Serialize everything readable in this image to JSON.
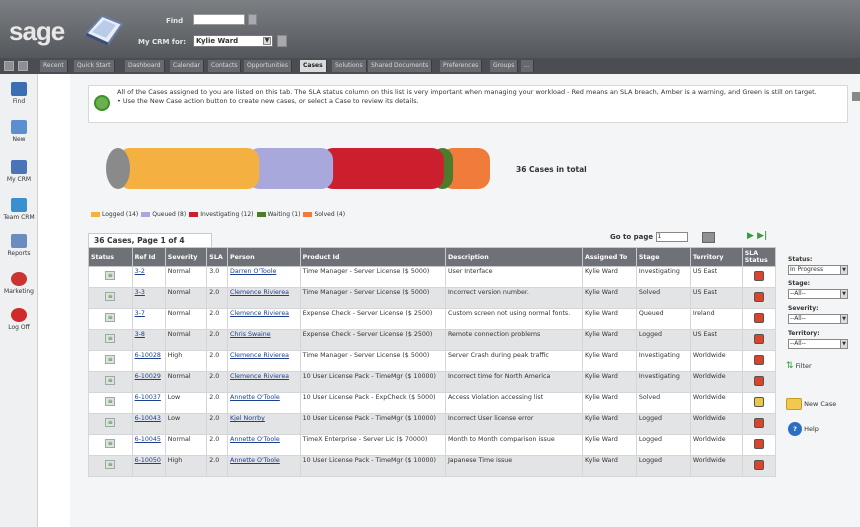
{
  "header": {
    "logo": "sage",
    "find_label": "Find",
    "find_value": "",
    "my_crm_label": "My CRM for:",
    "my_crm_user": "Kylie Ward"
  },
  "tabs": [
    "Quick Start",
    "Dashboard",
    "Calendar",
    "Contacts",
    "Opportunities",
    "Cases",
    "Solutions",
    "Shared Documents",
    "Preferences",
    "Groups",
    "..."
  ],
  "tabs_prefix": "Recent",
  "active_tab": "Cases",
  "sidebar": [
    {
      "label": "Find",
      "icon": "magnifier-icon"
    },
    {
      "label": "New",
      "icon": "new-document-icon"
    },
    {
      "label": "My CRM",
      "icon": "my-crm-icon"
    },
    {
      "label": "Team CRM",
      "icon": "team-crm-icon"
    },
    {
      "label": "Reports",
      "icon": "reports-icon"
    },
    {
      "label": "Marketing",
      "icon": "marketing-icon"
    },
    {
      "label": "Log Off",
      "icon": "log-off-icon"
    }
  ],
  "info": {
    "line1": "All of the Cases assigned to you are listed on this tab. The SLA status column on this list is very important when managing your workload - Red means an SLA breach, Amber is a warning, and Green is still on target.",
    "line2": "• Use the New Case action button to create new cases, or select a Case to review its details."
  },
  "summary": {
    "total_text": "36 Cases in total"
  },
  "legend": [
    {
      "label": "Logged (14)",
      "color": "#f5b042"
    },
    {
      "label": "Queued (8)",
      "color": "#a9a8dc"
    },
    {
      "label": "Investigating (12)",
      "color": "#cc1f2e"
    },
    {
      "label": "Waiting (1)",
      "color": "#4e7a2c"
    },
    {
      "label": "Solved (4)",
      "color": "#f07b3a"
    }
  ],
  "table": {
    "caption": "36 Cases, Page 1 of 4",
    "goto_label": "Go to page",
    "goto_value": "1",
    "columns": [
      "Status",
      "Ref Id",
      "Severity",
      "SLA",
      "Person",
      "Product Id",
      "Description",
      "Assigned To",
      "Stage",
      "Territory",
      "SLA Status"
    ],
    "rows": [
      {
        "ref": "3-2",
        "severity": "Normal",
        "sla": "3.0",
        "person": "Darren O'Toole",
        "product": "Time Manager - Server License ($ 5000)",
        "description": "User Interface",
        "assigned": "Kylie Ward",
        "stage": "Investigating",
        "territory": "US East",
        "sla_color": "#d9442a"
      },
      {
        "ref": "3-3",
        "severity": "Normal",
        "sla": "2.0",
        "person": "Clemence Rivierea",
        "product": "Time Manager - Server License ($ 5000)",
        "description": "Incorrect version number.",
        "assigned": "Kylie Ward",
        "stage": "Solved",
        "territory": "US East",
        "sla_color": "#d9442a"
      },
      {
        "ref": "3-7",
        "severity": "Normal",
        "sla": "2.0",
        "person": "Clemence Rivierea",
        "product": "Expense Check - Server License ($ 2500)",
        "description": "Custom screen not using normal fonts.",
        "assigned": "Kylie Ward",
        "stage": "Queued",
        "territory": "Ireland",
        "sla_color": "#d9442a"
      },
      {
        "ref": "3-8",
        "severity": "Normal",
        "sla": "2.0",
        "person": "Chris Swaine",
        "product": "Expense Check - Server License ($ 2500)",
        "description": "Remote connection problems",
        "assigned": "Kylie Ward",
        "stage": "Logged",
        "territory": "US East",
        "sla_color": "#d9442a"
      },
      {
        "ref": "6-10028",
        "severity": "High",
        "sla": "2.0",
        "person": "Clemence Rivierea",
        "product": "Time Manager - Server License ($ 5000)",
        "description": "Server Crash during peak traffic",
        "assigned": "Kylie Ward",
        "stage": "Investigating",
        "territory": "Worldwide",
        "sla_color": "#d9442a"
      },
      {
        "ref": "6-10029",
        "severity": "Normal",
        "sla": "2.0",
        "person": "Clemence Rivierea",
        "product": "10 User License Pack - TimeMgr ($ 10000)",
        "description": "Incorrect time for North America",
        "assigned": "Kylie Ward",
        "stage": "Investigating",
        "territory": "Worldwide",
        "sla_color": "#d9442a"
      },
      {
        "ref": "6-10037",
        "severity": "Low",
        "sla": "2.0",
        "person": "Annette O'Toole",
        "product": "10 User License Pack - ExpCheck ($ 5000)",
        "description": "Access Violation accessing list",
        "assigned": "Kylie Ward",
        "stage": "Solved",
        "territory": "Worldwide",
        "sla_color": "#e8c84a"
      },
      {
        "ref": "6-10043",
        "severity": "Low",
        "sla": "2.0",
        "person": "Kjel Norrby",
        "product": "10 User License Pack - TimeMgr ($ 10000)",
        "description": "Incorrect User license error",
        "assigned": "Kylie Ward",
        "stage": "Logged",
        "territory": "Worldwide",
        "sla_color": "#d9442a"
      },
      {
        "ref": "6-10045",
        "severity": "Normal",
        "sla": "2.0",
        "person": "Annette O'Toole",
        "product": "TimeX Enterprise - Server Lic ($ 70000)",
        "description": "Month to Month comparison issue",
        "assigned": "Kylie Ward",
        "stage": "Logged",
        "territory": "Worldwide",
        "sla_color": "#d9442a"
      },
      {
        "ref": "6-10050",
        "severity": "High",
        "sla": "2.0",
        "person": "Annette O'Toole",
        "product": "10 User License Pack - TimeMgr ($ 10000)",
        "description": "Japanese Time issue",
        "assigned": "Kylie Ward",
        "stage": "Logged",
        "territory": "Worldwide",
        "sla_color": "#d9442a"
      }
    ]
  },
  "filters": {
    "status_label": "Status:",
    "status_value": "In Progress",
    "stage_label": "Stage:",
    "stage_value": "--All--",
    "severity_label": "Severity:",
    "severity_value": "--All--",
    "territory_label": "Territory:",
    "territory_value": "--All--",
    "filter_button": "Filter"
  },
  "actions": {
    "new_case": "New Case",
    "help": "Help"
  }
}
